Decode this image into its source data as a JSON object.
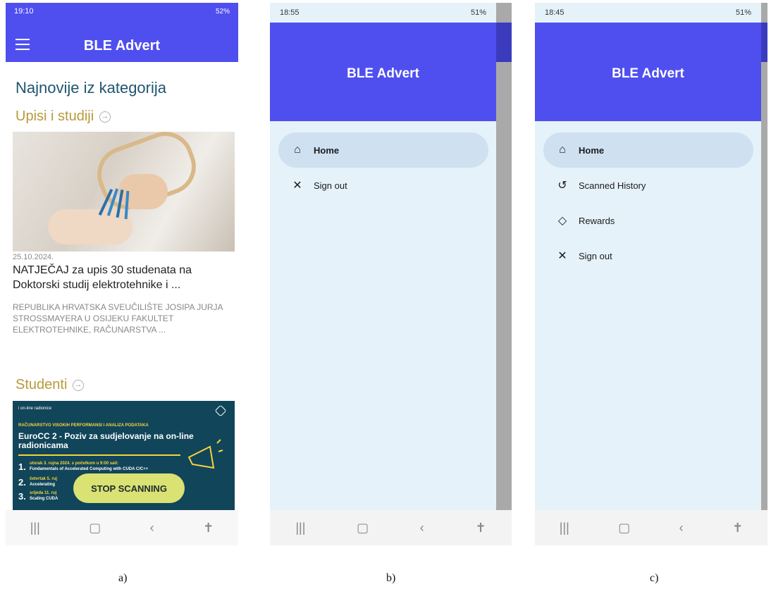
{
  "panel_a": {
    "status_time": "19:10",
    "status_right": "52%",
    "app_title": "BLE Advert",
    "section_heading": "Najnovije iz kategorija",
    "category_1": "Upisi i studiji",
    "news": {
      "date": "25.10.2024.",
      "title": "NATJEČAJ za upis 30 studenata na Doktorski studij elektrotehnike i ...",
      "description": "REPUBLIKA HRVATSKA SVEUČILIŠTE JOSIPA JURJA STROSSMAYERA U OSIJEKU FAKULTET ELEKTROTEHNIKE, RAČUNARSTVA ..."
    },
    "category_2": "Studenti",
    "banner": {
      "tag": "i on-line radionice",
      "subtitle": "RAČUNARSTVO VISOKIH PERFORMANSI I ANALIZA PODATAKA",
      "headline": "EuroCC 2 - Poziv za sudjelovanje na on-line radionicama",
      "item_1": "utorak 3. rujna 2024. s početkom u 9:00 sati:",
      "item_1b": "Fundamentals of Accelerated Computing with CUDA C/C++",
      "item_2": "četvrtak 5. ruj",
      "item_2b": "Accelerating",
      "item_3": "srijeda 11. ruj",
      "item_3b": "Scaling CUDA"
    },
    "stop_button": "STOP SCANNING",
    "caption": "a)"
  },
  "panel_b": {
    "status_time": "18:55",
    "status_right": "51%",
    "app_title": "BLE Advert",
    "menu": [
      {
        "label": "Home",
        "icon": "home-icon"
      },
      {
        "label": "Sign out",
        "icon": "close-icon"
      }
    ],
    "caption": "b)"
  },
  "panel_c": {
    "status_time": "18:45",
    "status_right": "51%",
    "app_title": "BLE Advert",
    "menu": [
      {
        "label": "Home",
        "icon": "home-icon"
      },
      {
        "label": "Scanned History",
        "icon": "history-icon"
      },
      {
        "label": "Rewards",
        "icon": "tag-icon"
      },
      {
        "label": "Sign out",
        "icon": "close-icon"
      }
    ],
    "caption": "c)"
  },
  "colors": {
    "app_bar": "#4f4ff0",
    "drawer_bg": "#e6f2fa",
    "active_item": "#cfe1f0",
    "category_gold": "#b89a3c",
    "button": "#d9e272"
  }
}
